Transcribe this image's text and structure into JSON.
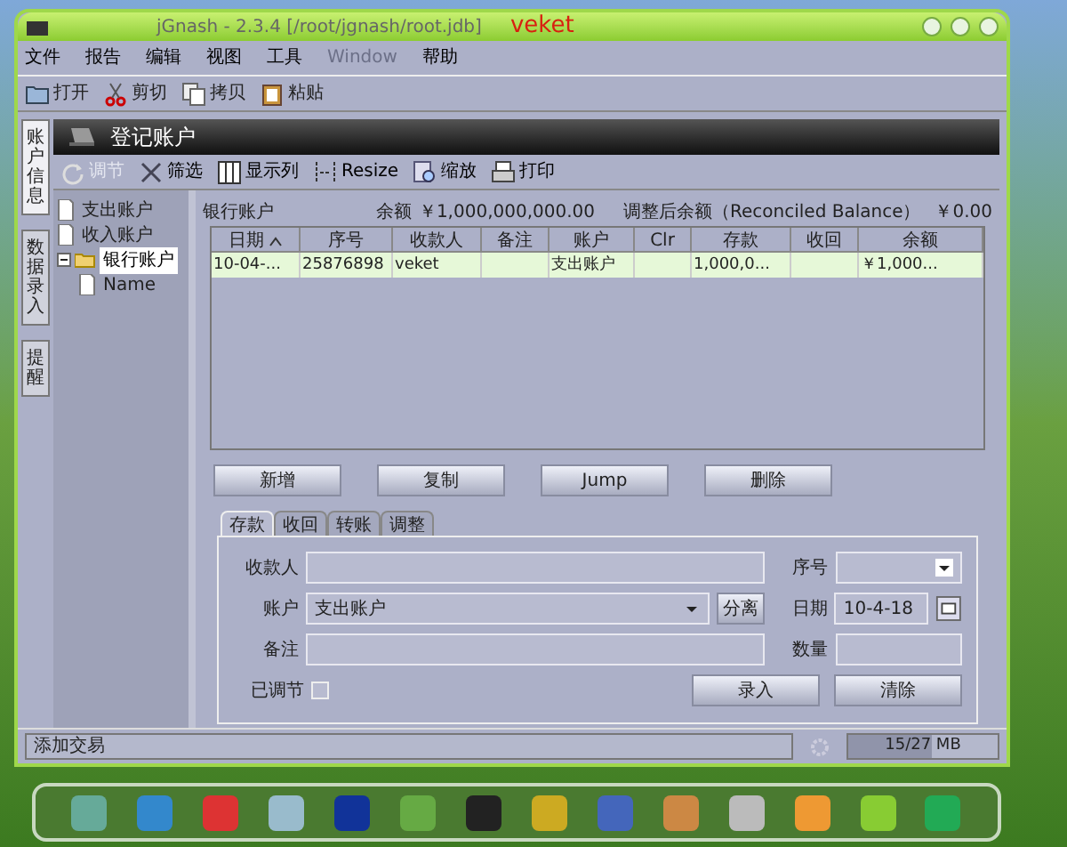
{
  "window": {
    "title": "jGnash - 2.3.4  [/root/jgnash/root.jdb]",
    "user": "veket"
  },
  "menu": [
    {
      "label": "文件",
      "disabled": false
    },
    {
      "label": "报告",
      "disabled": false
    },
    {
      "label": "编辑",
      "disabled": false
    },
    {
      "label": "视图",
      "disabled": false
    },
    {
      "label": "工具",
      "disabled": false
    },
    {
      "label": "Window",
      "disabled": true
    },
    {
      "label": "帮助",
      "disabled": false
    }
  ],
  "toolbar": [
    {
      "label": "打开"
    },
    {
      "label": "剪切"
    },
    {
      "label": "拷贝"
    },
    {
      "label": "粘贴"
    }
  ],
  "side_tabs": [
    {
      "label": "账户信息",
      "selected": true
    },
    {
      "label": "数据录入",
      "selected": false
    },
    {
      "label": "提醒",
      "selected": false
    }
  ],
  "panel_title": "登记账户",
  "register_toolbar": [
    {
      "label": "调节",
      "disabled": true
    },
    {
      "label": "筛选",
      "disabled": false
    },
    {
      "label": "显示列",
      "disabled": false
    },
    {
      "label": "Resize",
      "disabled": false
    },
    {
      "label": "缩放",
      "disabled": false
    },
    {
      "label": "打印",
      "disabled": false
    }
  ],
  "tree": [
    {
      "label": "支出账户",
      "kind": "file",
      "selected": false
    },
    {
      "label": "收入账户",
      "kind": "file",
      "selected": false
    },
    {
      "label": "银行账户",
      "kind": "folder",
      "selected": true,
      "expanded": true,
      "children": [
        {
          "label": "Name",
          "kind": "file",
          "selected": false
        }
      ]
    }
  ],
  "account": {
    "name": "银行账户",
    "balance_label": "余额",
    "balance": "￥1,000,000,000.00",
    "reconciled_label": "调整后余额（Reconciled Balance）",
    "reconciled": "￥0.00"
  },
  "table": {
    "columns": [
      {
        "label": "日期",
        "sorted": true
      },
      {
        "label": "序号",
        "sorted": false
      },
      {
        "label": "收款人",
        "sorted": false
      },
      {
        "label": "备注",
        "sorted": false
      },
      {
        "label": "账户",
        "sorted": false
      },
      {
        "label": "Clr",
        "sorted": false
      },
      {
        "label": "存款",
        "sorted": false
      },
      {
        "label": "收回",
        "sorted": false
      },
      {
        "label": "余额",
        "sorted": false
      }
    ],
    "rows": [
      {
        "selected": true,
        "cells": [
          "10-04-...",
          "25876898",
          "veket",
          "",
          "支出账户",
          "",
          "1,000,0...",
          "",
          "￥1,000..."
        ]
      }
    ]
  },
  "actions": [
    "新增",
    "复制",
    "Jump",
    "删除"
  ],
  "form_tabs": [
    {
      "label": "存款",
      "selected": true
    },
    {
      "label": "收回",
      "selected": false
    },
    {
      "label": "转账",
      "selected": false
    },
    {
      "label": "调整",
      "selected": false
    }
  ],
  "form": {
    "payee_label": "收款人",
    "number_label": "序号",
    "account_label": "账户",
    "account_value": "支出账户",
    "split_button": "分离",
    "date_label": "日期",
    "date_value": "10-4-18",
    "memo_label": "备注",
    "quantity_label": "数量",
    "reconciled_label": "已调节",
    "reconciled": false,
    "enter_button": "录入",
    "clear_button": "清除"
  },
  "status_bar": {
    "message": "添加交易",
    "memory": "15/27 MB",
    "level": 0.56
  }
}
